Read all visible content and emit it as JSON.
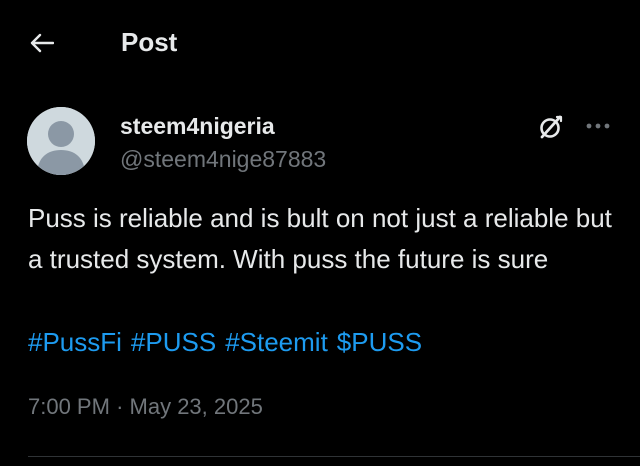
{
  "header": {
    "back_icon": "arrow-left-icon",
    "title": "Post"
  },
  "post": {
    "author": {
      "display_name": "steem4nigeria",
      "handle": "@steem4nige87883",
      "avatar": "default-avatar-icon"
    },
    "actions": {
      "grok_icon": "grok-icon",
      "more_icon": "more-horizontal-icon"
    },
    "text": "Puss is reliable and is bult on not just a reliable but a trusted system. With puss the future is sure",
    "hashtags": [
      "#PussFi",
      "#PUSS",
      "#Steemit",
      "$PUSS"
    ],
    "time": "7:00 PM",
    "separator": "·",
    "date": "May 23, 2025"
  },
  "colors": {
    "background": "#000000",
    "text_primary": "#e7e9ea",
    "text_secondary": "#71767b",
    "link": "#1d9bf0",
    "divider": "#2f3336",
    "avatar_bg": "#cfd9de",
    "avatar_fg": "#8b98a5"
  }
}
